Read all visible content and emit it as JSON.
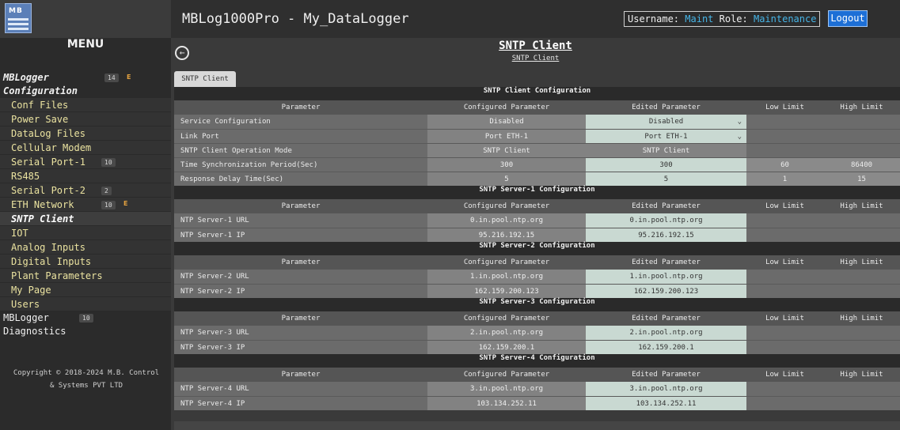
{
  "header": {
    "logo_text": "MB",
    "app_title": "MBLog1000Pro - My_DataLogger",
    "username_label": "Username:",
    "username": "Maint",
    "role_label": "Role:",
    "role": "Maintenance",
    "logout_label": "Logout"
  },
  "sidebar": {
    "menu_title": "MENU",
    "group1": {
      "line1": "MBLogger",
      "line2": "Configuration",
      "badge": "14",
      "flag": "E"
    },
    "items": [
      {
        "label": "Conf Files"
      },
      {
        "label": "Power Save"
      },
      {
        "label": "DataLog Files"
      },
      {
        "label": "Cellular Modem"
      },
      {
        "label": "Serial Port-1",
        "badge": "10"
      },
      {
        "label": "RS485"
      },
      {
        "label": "Serial Port-2",
        "badge": "2"
      },
      {
        "label": "ETH Network",
        "badge": "10",
        "flag": "E"
      },
      {
        "label": "SNTP Client"
      },
      {
        "label": "IOT"
      },
      {
        "label": "Analog Inputs"
      },
      {
        "label": "Digital Inputs"
      },
      {
        "label": "Plant Parameters"
      },
      {
        "label": "My Page"
      },
      {
        "label": "Users"
      }
    ],
    "group2": {
      "line1": "MBLogger",
      "line2": "Diagnostics",
      "badge": "10"
    },
    "copyright": "Copyright © 2018-2024 M.B. Control & Systems PVT LTD"
  },
  "page": {
    "title": "SNTP Client",
    "subtitle": "SNTP Client",
    "tab": "SNTP Client"
  },
  "columns": {
    "parameter": "Parameter",
    "configured": "Configured Parameter",
    "edited": "Edited Parameter",
    "low": "Low Limit",
    "high": "High Limit"
  },
  "client_config": {
    "title": "SNTP Client Configuration",
    "rows": [
      {
        "param": "Service Configuration",
        "configured": "Disabled",
        "edited": "Disabled",
        "low": "",
        "high": ""
      },
      {
        "param": "Link Port",
        "configured": "Port ETH-1",
        "edited": "Port ETH-1",
        "low": "",
        "high": ""
      },
      {
        "param": "SNTP Client Operation Mode",
        "configured": "SNTP Client",
        "edited": "SNTP Client",
        "low": "",
        "high": ""
      },
      {
        "param": "Time Synchronization Period(Sec)",
        "configured": "300",
        "edited": "300",
        "low": "60",
        "high": "86400"
      },
      {
        "param": "Response Delay Time(Sec)",
        "configured": "5",
        "edited": "5",
        "low": "1",
        "high": "15"
      }
    ]
  },
  "servers": [
    {
      "title": "SNTP Server-1 Configuration",
      "rows": [
        {
          "param": "NTP Server-1 URL",
          "configured": "0.in.pool.ntp.org",
          "edited": "0.in.pool.ntp.org"
        },
        {
          "param": "NTP Server-1 IP",
          "configured": "95.216.192.15",
          "edited": "95.216.192.15"
        }
      ]
    },
    {
      "title": "SNTP Server-2 Configuration",
      "rows": [
        {
          "param": "NTP Server-2 URL",
          "configured": "1.in.pool.ntp.org",
          "edited": "1.in.pool.ntp.org"
        },
        {
          "param": "NTP Server-2 IP",
          "configured": "162.159.200.123",
          "edited": "162.159.200.123"
        }
      ]
    },
    {
      "title": "SNTP Server-3 Configuration",
      "rows": [
        {
          "param": "NTP Server-3 URL",
          "configured": "2.in.pool.ntp.org",
          "edited": "2.in.pool.ntp.org"
        },
        {
          "param": "NTP Server-3 IP",
          "configured": "162.159.200.1",
          "edited": "162.159.200.1"
        }
      ]
    },
    {
      "title": "SNTP Server-4 Configuration",
      "rows": [
        {
          "param": "NTP Server-4 URL",
          "configured": "3.in.pool.ntp.org",
          "edited": "3.in.pool.ntp.org"
        },
        {
          "param": "NTP Server-4 IP",
          "configured": "103.134.252.11",
          "edited": "103.134.252.11"
        }
      ]
    }
  ],
  "icons": {
    "back": "back-arrow-icon",
    "dropdown": "chevron-down-icon"
  }
}
